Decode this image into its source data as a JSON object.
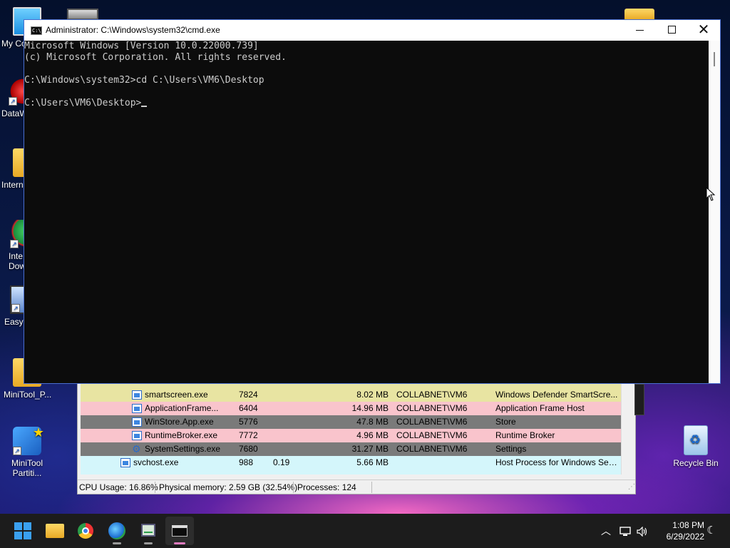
{
  "desktop": {
    "icons": [
      {
        "label": "My Co"
      },
      {
        "label": "DataW"
      },
      {
        "label": "Intern"
      },
      {
        "label": "Inte Dow"
      },
      {
        "label": "EasyE"
      },
      {
        "label": "MiniTool_P..."
      },
      {
        "label": "MiniTool Partiti..."
      }
    ],
    "recycle_bin": "Recycle Bin"
  },
  "cmd_window": {
    "title": "Administrator: C:\\Windows\\system32\\cmd.exe",
    "icon_text": "C:\\",
    "lines": [
      "Microsoft Windows [Version 10.0.22000.739]",
      "(c) Microsoft Corporation. All rights reserved.",
      "",
      "C:\\Windows\\system32>cd C:\\Users\\VM6\\Desktop",
      "",
      "C:\\Users\\VM6\\Desktop>"
    ]
  },
  "task_manager": {
    "rows": [
      {
        "name": "smartscreen.exe",
        "pid": "7824",
        "cpu": "",
        "memory": "8.02 MB",
        "user": "COLLABNET\\VM6",
        "description": "Windows Defender SmartScre...",
        "color": "#e8e4a2",
        "icon": "app"
      },
      {
        "name": "ApplicationFrame...",
        "pid": "6404",
        "cpu": "",
        "memory": "14.96 MB",
        "user": "COLLABNET\\VM6",
        "description": "Application Frame Host",
        "color": "#f9c4cc",
        "icon": "app"
      },
      {
        "name": "WinStore.App.exe",
        "pid": "5776",
        "cpu": "",
        "memory": "47.8 MB",
        "user": "COLLABNET\\VM6",
        "description": "Store",
        "color": "#7a7a7a",
        "icon": "app"
      },
      {
        "name": "RuntimeBroker.exe",
        "pid": "7772",
        "cpu": "",
        "memory": "4.96 MB",
        "user": "COLLABNET\\VM6",
        "description": "Runtime Broker",
        "color": "#f9c4cc",
        "icon": "app"
      },
      {
        "name": "SystemSettings.exe",
        "pid": "7680",
        "cpu": "",
        "memory": "31.27 MB",
        "user": "COLLABNET\\VM6",
        "description": "Settings",
        "color": "#7a7a7a",
        "icon": "gear"
      },
      {
        "name": "svchost.exe",
        "pid": "988",
        "cpu": "0.19",
        "memory": "5.66 MB",
        "user": "",
        "description": "Host Process for Windows Ser...",
        "color": "#d4f6fb",
        "icon": "app"
      }
    ],
    "status": {
      "cpu": "CPU Usage: 16.86%",
      "memory": "Physical memory: 2.59 GB (32.54%)",
      "processes": "Processes: 124"
    }
  },
  "taskbar": {
    "clock_time": "1:08 PM",
    "clock_date": "6/29/2022",
    "accent": "#e07cc0"
  }
}
